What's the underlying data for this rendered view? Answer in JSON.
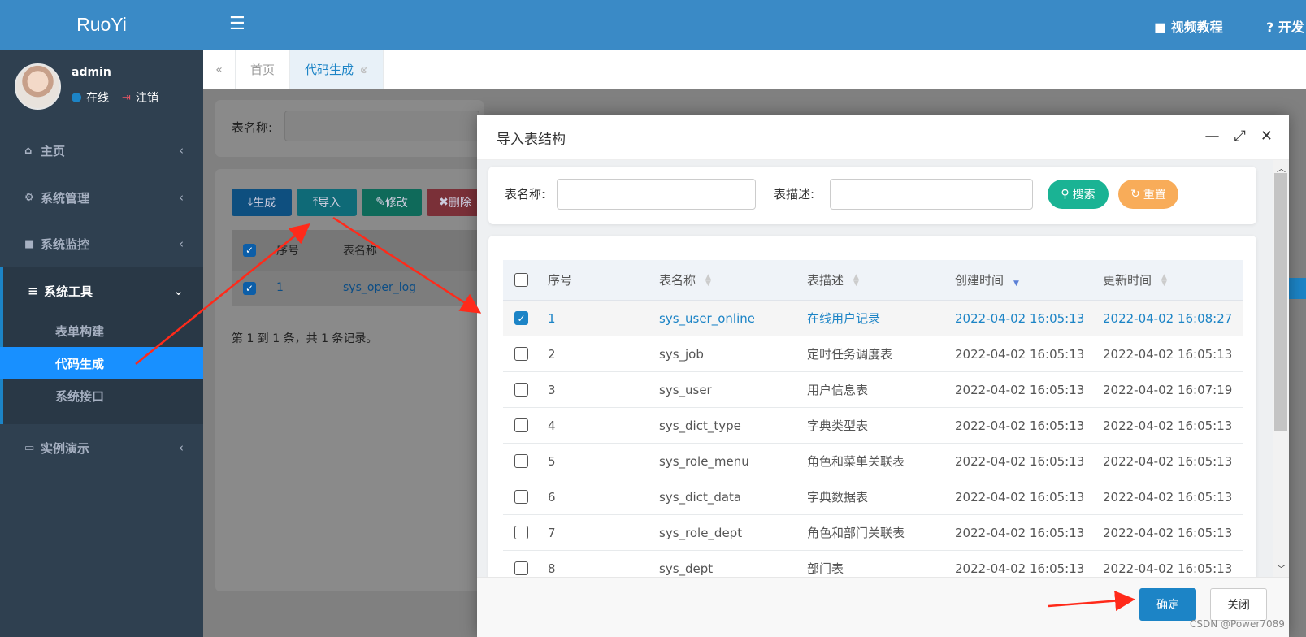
{
  "app": {
    "logo": "RuoYi"
  },
  "user": {
    "name": "admin",
    "status": "在线",
    "logout": "注销"
  },
  "sidebar": {
    "items": [
      {
        "label": "主页",
        "icon": "home-icon"
      },
      {
        "label": "系统管理",
        "icon": "gear-icon"
      },
      {
        "label": "系统监控",
        "icon": "video-icon"
      },
      {
        "label": "系统工具",
        "icon": "menu-icon"
      },
      {
        "label": "实例演示",
        "icon": "desktop-icon"
      }
    ],
    "sub_items": [
      "表单构建",
      "代码生成",
      "系统接口"
    ]
  },
  "topbar": {
    "video": "视频教程",
    "help": "开发"
  },
  "tabs": [
    "首页",
    "代码生成"
  ],
  "background": {
    "search_label": "表名称:",
    "buttons": [
      "生成",
      "导入",
      "修改",
      "删除"
    ],
    "columns": [
      "序号",
      "表名称"
    ],
    "row": {
      "no": "1",
      "name": "sys_oper_log"
    },
    "pager": "第 1 到 1 条，共 1 条记录。"
  },
  "modal": {
    "title": "导入表结构",
    "search": {
      "name_label": "表名称:",
      "desc_label": "表描述:",
      "search_btn": "搜索",
      "reset_btn": "重置"
    },
    "columns": [
      "序号",
      "表名称",
      "表描述",
      "创建时间",
      "更新时间"
    ],
    "rows": [
      {
        "no": "1",
        "name": "sys_user_online",
        "desc": "在线用户记录",
        "created": "2022-04-02 16:05:13",
        "updated": "2022-04-02 16:08:27",
        "checked": true
      },
      {
        "no": "2",
        "name": "sys_job",
        "desc": "定时任务调度表",
        "created": "2022-04-02 16:05:13",
        "updated": "2022-04-02 16:05:13",
        "checked": false
      },
      {
        "no": "3",
        "name": "sys_user",
        "desc": "用户信息表",
        "created": "2022-04-02 16:05:13",
        "updated": "2022-04-02 16:07:19",
        "checked": false
      },
      {
        "no": "4",
        "name": "sys_dict_type",
        "desc": "字典类型表",
        "created": "2022-04-02 16:05:13",
        "updated": "2022-04-02 16:05:13",
        "checked": false
      },
      {
        "no": "5",
        "name": "sys_role_menu",
        "desc": "角色和菜单关联表",
        "created": "2022-04-02 16:05:13",
        "updated": "2022-04-02 16:05:13",
        "checked": false
      },
      {
        "no": "6",
        "name": "sys_dict_data",
        "desc": "字典数据表",
        "created": "2022-04-02 16:05:13",
        "updated": "2022-04-02 16:05:13",
        "checked": false
      },
      {
        "no": "7",
        "name": "sys_role_dept",
        "desc": "角色和部门关联表",
        "created": "2022-04-02 16:05:13",
        "updated": "2022-04-02 16:05:13",
        "checked": false
      },
      {
        "no": "8",
        "name": "sys_dept",
        "desc": "部门表",
        "created": "2022-04-02 16:05:13",
        "updated": "2022-04-02 16:05:13",
        "checked": false
      }
    ],
    "ok": "确定",
    "cancel": "关闭"
  },
  "watermark": "CSDN @Power7089",
  "colors": {
    "primary": "#1c84c6",
    "sidebar": "#2f4050",
    "header": "#3a8ac6",
    "success": "#1ab394",
    "warning": "#f8ac59",
    "arrow": "#ff2a1a"
  }
}
